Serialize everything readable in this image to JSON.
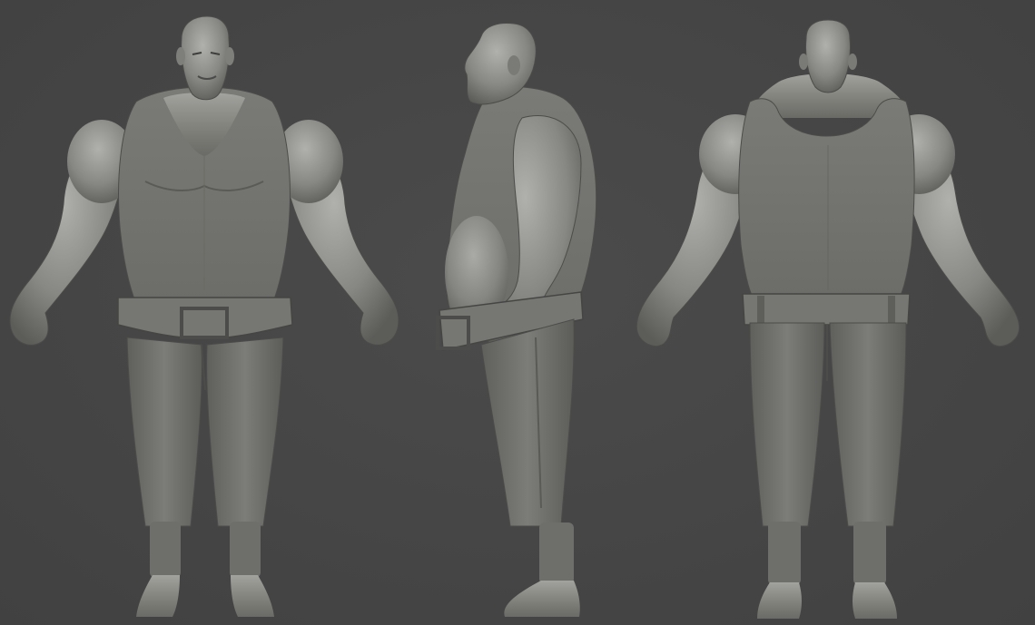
{
  "scene": {
    "background_color": "#464646",
    "clay_color": "#8a8a86",
    "clay_highlight": "#b4b4b0",
    "clay_shadow": "#4f4f4d",
    "views": [
      {
        "name": "front-view"
      },
      {
        "name": "side-view"
      },
      {
        "name": "back-view"
      }
    ]
  }
}
